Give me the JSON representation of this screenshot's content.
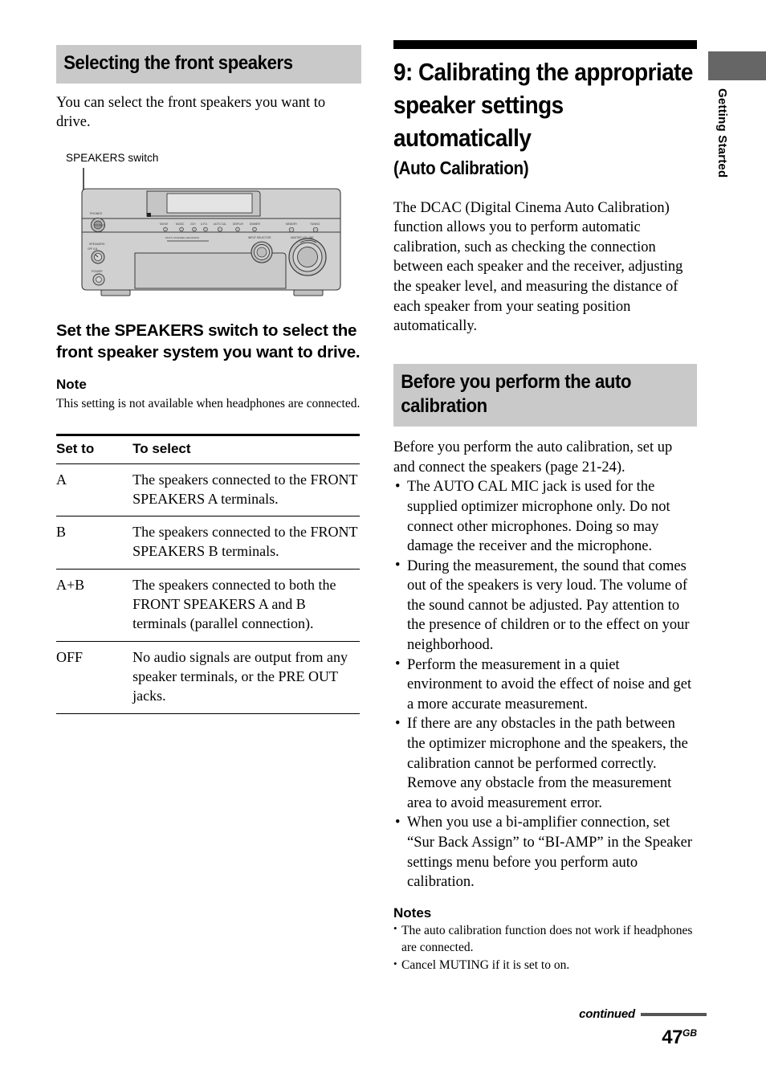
{
  "sidebar_tab": {
    "label": "Getting Started",
    "block_color": "#666666"
  },
  "left_column": {
    "section_heading": "Selecting the front speakers",
    "intro": "You can select the front speakers you want to drive.",
    "figure": {
      "caption": "SPEAKERS switch",
      "device_labels": {
        "headphones": "PHONES",
        "speakers": "SPEAKERS",
        "speakers_positions": "OFF  A  B",
        "power": "POWER",
        "multi_channel": "MULTI CHANNEL DECODING",
        "input_selector": "INPUT SELECTOR",
        "master_volume": "MASTER VOLUME",
        "right_indicators": [
          "MEMORY",
          "TUNING"
        ],
        "center_indicators": [
          "MOVIE",
          "MUSIC",
          "A.F.D.",
          "2CH",
          "AUTO CAL",
          "DISPLAY",
          "DIMMER"
        ]
      }
    },
    "step_instruction": "Set the SPEAKERS switch to select the front speaker system you want to drive.",
    "note_heading": "Note",
    "note_text": "This setting is not available when headphones are connected.",
    "table": {
      "headers": [
        "Set to",
        "To select"
      ],
      "rows": [
        {
          "set_to": "A",
          "to_select": "The speakers connected to the FRONT SPEAKERS A terminals."
        },
        {
          "set_to": "B",
          "to_select": "The speakers connected to the FRONT SPEAKERS B terminals."
        },
        {
          "set_to": "A+B",
          "to_select": "The speakers connected to both the FRONT SPEAKERS A and B terminals (parallel connection)."
        },
        {
          "set_to": "OFF",
          "to_select": "No audio signals are output from any speaker terminals, or the PRE OUT jacks."
        }
      ]
    }
  },
  "right_column": {
    "chapter_title": "9: Calibrating the appropriate speaker settings automatically",
    "chapter_subtitle": "(Auto Calibration)",
    "intro_paragraph": "The DCAC (Digital Cinema Auto Calibration) function allows you to perform automatic calibration, such as checking the connection between each speaker and the receiver, adjusting the speaker level, and measuring the distance of each speaker from your seating position automatically.",
    "section_heading": "Before you perform the auto calibration",
    "section_intro": "Before you perform the auto calibration, set up and connect the speakers (page 21-24).",
    "bullets": [
      "The AUTO CAL MIC jack is used for the supplied optimizer microphone only. Do not connect other microphones. Doing so may damage the receiver and the microphone.",
      "During the measurement, the sound that comes out of the speakers is very loud. The volume of the sound cannot be adjusted. Pay attention to the presence of children or to the effect on your neighborhood.",
      "Perform the measurement in a quiet environment to avoid the effect of noise and get a more accurate measurement.",
      "If there are any obstacles in the path between the optimizer microphone and the speakers, the calibration cannot be performed correctly. Remove any obstacle from the measurement area to avoid measurement error.",
      "When you use a bi-amplifier connection, set “Sur Back Assign” to “BI-AMP” in the Speaker settings menu before you perform auto calibration."
    ],
    "notes_heading": "Notes",
    "notes": [
      "The auto calibration function does not work if headphones are connected.",
      "Cancel MUTING if it is set to on."
    ]
  },
  "footer": {
    "continued_label": "continued",
    "page_number": "47",
    "page_suffix": "GB"
  },
  "bullet_glyph": "•",
  "colors": {
    "heading_background": "#c9c9c9",
    "rule_black": "#000000",
    "tab_gray": "#666666"
  }
}
